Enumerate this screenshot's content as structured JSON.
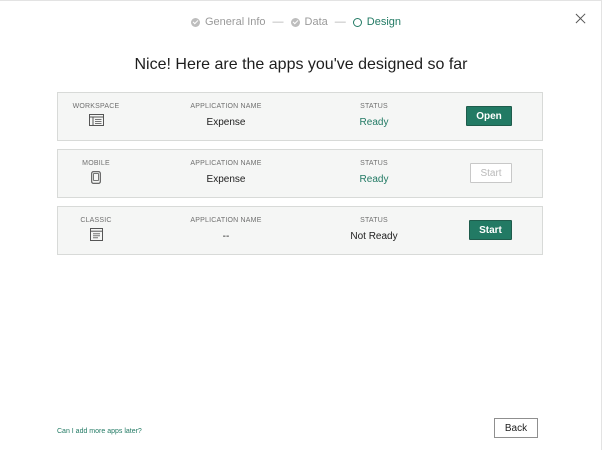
{
  "stepper": {
    "steps": [
      {
        "label": "General Info",
        "state": "done",
        "icon": "check-circle-icon"
      },
      {
        "label": "Data",
        "state": "done",
        "icon": "check-circle-icon"
      },
      {
        "label": "Design",
        "state": "current",
        "icon": "open-circle-icon"
      }
    ],
    "separator": "—"
  },
  "title": "Nice! Here are the apps you've designed so far",
  "columns": {
    "name": "APPLICATION NAME",
    "status": "STATUS"
  },
  "apps": [
    {
      "type": "WORKSPACE",
      "icon": "workspace-icon",
      "name": "Expense",
      "status": "Ready",
      "action": "Open",
      "action_state": "enabled"
    },
    {
      "type": "MOBILE",
      "icon": "mobile-icon",
      "name": "Expense",
      "status": "Ready",
      "action": "Start",
      "action_state": "disabled"
    },
    {
      "type": "CLASSIC",
      "icon": "classic-icon",
      "name": "--",
      "status": "Not Ready",
      "action": "Start",
      "action_state": "enabled"
    }
  ],
  "footer": {
    "help_link": "Can I add more apps later?",
    "back_label": "Back"
  },
  "colors": {
    "accent": "#227a64",
    "card_bg": "#f5f6f5",
    "border": "#d8dad8"
  }
}
